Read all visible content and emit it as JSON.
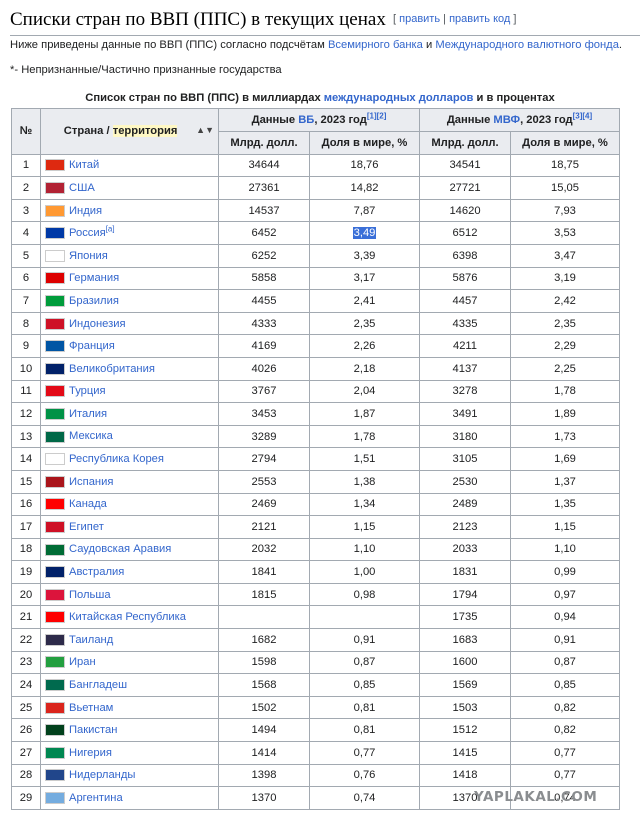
{
  "heading": {
    "title": "Списки стран по ВВП (ППС) в текущих ценах",
    "edit": "править",
    "edit_code": "править код"
  },
  "intro": {
    "text": "Ниже приведены данные по ВВП (ППС) согласно подсчётам ",
    "wb": "Всемирного банка",
    "and": " и ",
    "imf": "Международного валютного фонда",
    "end": "."
  },
  "note": "*- Непризнанные/Частично признанные государства",
  "caption": {
    "pre": "Список стран по ВВП (ППС) в миллиардах ",
    "link": "международных долларов",
    "post": " и в процентах"
  },
  "header": {
    "no": "№",
    "country": "Страна / ",
    "territory": "территория",
    "wb_group": "Данные ",
    "wb_abbr": "ВБ",
    "wb_year": ", 2023 год",
    "wb_refs": "[1][2]",
    "imf_group": "Данные ",
    "imf_abbr": "МВФ",
    "imf_year": ", 2023 год",
    "imf_refs": "[3][4]",
    "col_bn": "Млрд. долл.",
    "col_share": "Доля в мире, %",
    "sort_icon": "▲▼"
  },
  "rows": [
    {
      "n": "1",
      "country": "Китай",
      "wb": "34644",
      "wbs": "18,76",
      "imf": "34541",
      "imfs": "18,75",
      "flag": "#de2910"
    },
    {
      "n": "2",
      "country": "США",
      "wb": "27361",
      "wbs": "14,82",
      "imf": "27721",
      "imfs": "15,05",
      "flag": "#b22234"
    },
    {
      "n": "3",
      "country": "Индия",
      "wb": "14537",
      "wbs": "7,87",
      "imf": "14620",
      "imfs": "7,93",
      "flag": "#ff9933"
    },
    {
      "n": "4",
      "country": "Россия",
      "note": "[a]",
      "wb": "6452",
      "wbs": "3,49",
      "imf": "6512",
      "imfs": "3,53",
      "flag": "#0039a6"
    },
    {
      "n": "5",
      "country": "Япония",
      "wb": "6252",
      "wbs": "3,39",
      "imf": "6398",
      "imfs": "3,47",
      "flag": "#ffffff"
    },
    {
      "n": "6",
      "country": "Германия",
      "wb": "5858",
      "wbs": "3,17",
      "imf": "5876",
      "imfs": "3,19",
      "flag": "#dd0000"
    },
    {
      "n": "7",
      "country": "Бразилия",
      "wb": "4455",
      "wbs": "2,41",
      "imf": "4457",
      "imfs": "2,42",
      "flag": "#009c3b"
    },
    {
      "n": "8",
      "country": "Индонезия",
      "wb": "4333",
      "wbs": "2,35",
      "imf": "4335",
      "imfs": "2,35",
      "flag": "#ce1126"
    },
    {
      "n": "9",
      "country": "Франция",
      "wb": "4169",
      "wbs": "2,26",
      "imf": "4211",
      "imfs": "2,29",
      "flag": "#0055a4"
    },
    {
      "n": "10",
      "country": "Великобритания",
      "wb": "4026",
      "wbs": "2,18",
      "imf": "4137",
      "imfs": "2,25",
      "flag": "#012169"
    },
    {
      "n": "11",
      "country": "Турция",
      "wb": "3767",
      "wbs": "2,04",
      "imf": "3278",
      "imfs": "1,78",
      "flag": "#e30a17"
    },
    {
      "n": "12",
      "country": "Италия",
      "wb": "3453",
      "wbs": "1,87",
      "imf": "3491",
      "imfs": "1,89",
      "flag": "#009246"
    },
    {
      "n": "13",
      "country": "Мексика",
      "wb": "3289",
      "wbs": "1,78",
      "imf": "3180",
      "imfs": "1,73",
      "flag": "#006847"
    },
    {
      "n": "14",
      "country": "Республика Корея",
      "wb": "2794",
      "wbs": "1,51",
      "imf": "3105",
      "imfs": "1,69",
      "flag": "#ffffff"
    },
    {
      "n": "15",
      "country": "Испания",
      "wb": "2553",
      "wbs": "1,38",
      "imf": "2530",
      "imfs": "1,37",
      "flag": "#aa151b"
    },
    {
      "n": "16",
      "country": "Канада",
      "wb": "2469",
      "wbs": "1,34",
      "imf": "2489",
      "imfs": "1,35",
      "flag": "#ff0000"
    },
    {
      "n": "17",
      "country": "Египет",
      "wb": "2121",
      "wbs": "1,15",
      "imf": "2123",
      "imfs": "1,15",
      "flag": "#ce1126"
    },
    {
      "n": "18",
      "country": "Саудовская Аравия",
      "wb": "2032",
      "wbs": "1,10",
      "imf": "2033",
      "imfs": "1,10",
      "flag": "#006c35"
    },
    {
      "n": "19",
      "country": "Австралия",
      "wb": "1841",
      "wbs": "1,00",
      "imf": "1831",
      "imfs": "0,99",
      "flag": "#012169"
    },
    {
      "n": "20",
      "country": "Польша",
      "wb": "1815",
      "wbs": "0,98",
      "imf": "1794",
      "imfs": "0,97",
      "flag": "#dc143c"
    },
    {
      "n": "21",
      "country": "Китайская Республика",
      "wb": "",
      "wbs": "",
      "imf": "1735",
      "imfs": "0,94",
      "flag": "#fe0000"
    },
    {
      "n": "22",
      "country": "Таиланд",
      "wb": "1682",
      "wbs": "0,91",
      "imf": "1683",
      "imfs": "0,91",
      "flag": "#2d2a4a"
    },
    {
      "n": "23",
      "country": "Иран",
      "wb": "1598",
      "wbs": "0,87",
      "imf": "1600",
      "imfs": "0,87",
      "flag": "#239f40"
    },
    {
      "n": "24",
      "country": "Бангладеш",
      "wb": "1568",
      "wbs": "0,85",
      "imf": "1569",
      "imfs": "0,85",
      "flag": "#006a4e"
    },
    {
      "n": "25",
      "country": "Вьетнам",
      "wb": "1502",
      "wbs": "0,81",
      "imf": "1503",
      "imfs": "0,82",
      "flag": "#da251d"
    },
    {
      "n": "26",
      "country": "Пакистан",
      "wb": "1494",
      "wbs": "0,81",
      "imf": "1512",
      "imfs": "0,82",
      "flag": "#01411c"
    },
    {
      "n": "27",
      "country": "Нигерия",
      "wb": "1414",
      "wbs": "0,77",
      "imf": "1415",
      "imfs": "0,77",
      "flag": "#008751"
    },
    {
      "n": "28",
      "country": "Нидерланды",
      "wb": "1398",
      "wbs": "0,76",
      "imf": "1418",
      "imfs": "0,77",
      "flag": "#21468b"
    },
    {
      "n": "29",
      "country": "Аргентина",
      "wb": "1370",
      "wbs": "0,74",
      "imf": "1370",
      "imfs": "0,74",
      "flag": "#74acdf"
    }
  ],
  "selected_cell": "3,49",
  "watermark": "YAPLAKAL.COM",
  "colors": {
    "link": "#3366cc",
    "header_bg": "#eaecf0",
    "border": "#a2a9b1",
    "selection": "#3a6fd8"
  }
}
